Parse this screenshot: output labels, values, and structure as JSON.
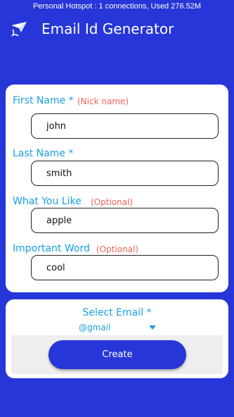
{
  "status_bar": {
    "text": "Personal Hotspot : 1 connections, Used 276.52M"
  },
  "app_bar": {
    "title": "Email Id Generator",
    "icon": "paper-plane-icon"
  },
  "form": {
    "fields": [
      {
        "label": "First Name *",
        "hint": "(Nick name)",
        "value": "john"
      },
      {
        "label": "Last Name *",
        "hint": "",
        "value": "smith"
      },
      {
        "label": "What You Like",
        "hint": "(Optional)",
        "value": "apple"
      },
      {
        "label": "Important Word",
        "hint": "(Optional)",
        "value": "cool"
      }
    ]
  },
  "select_email": {
    "label": "Select Email *",
    "selected": "@gmail"
  },
  "actions": {
    "create_label": "Create"
  },
  "colors": {
    "background": "#2636d8",
    "label": "#1a9fe0",
    "hint": "#f0645a",
    "button": "#2636d8"
  }
}
